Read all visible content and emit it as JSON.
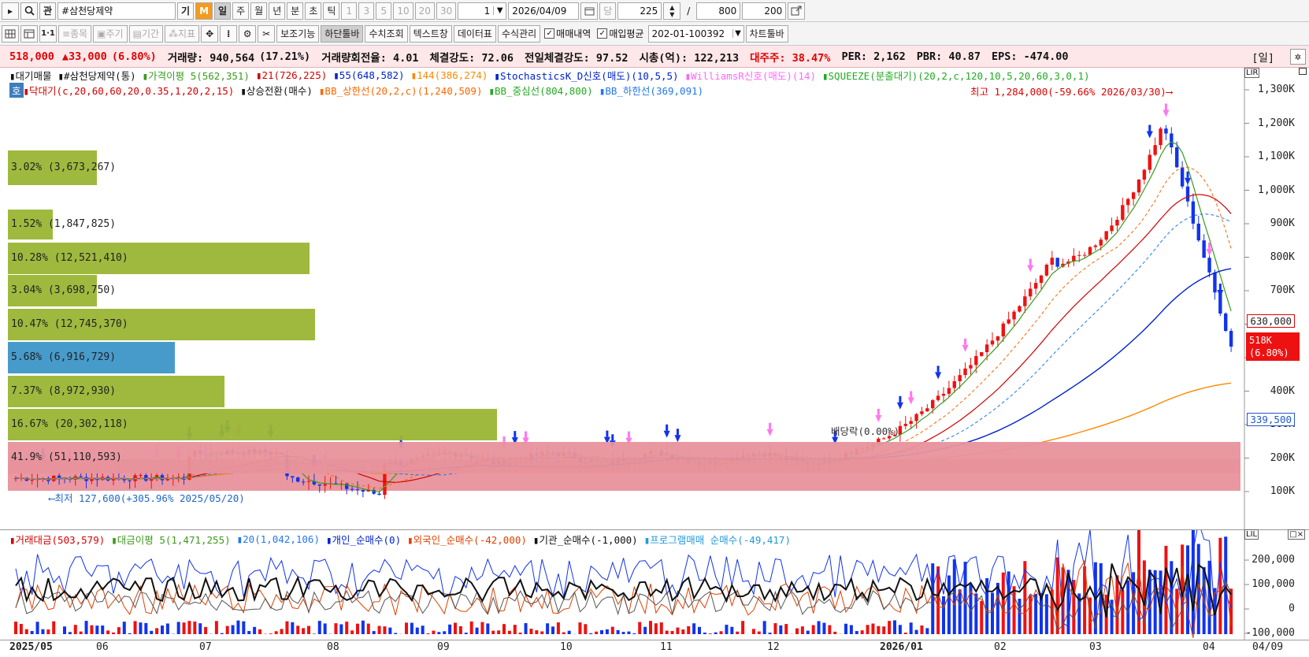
{
  "toolbar1": {
    "nav_arrow": "▸",
    "search_icon": "search-icon",
    "gwan_label": "관",
    "stock_name": "#삼천당제약",
    "gi_label": "기",
    "m_label": "M",
    "periods": [
      "일",
      "주",
      "월",
      "년",
      "분",
      "초",
      "틱"
    ],
    "minutes": [
      "1",
      "3",
      "5",
      "10",
      "20",
      "30"
    ],
    "count_value": "1",
    "date_value": "2026/04/09",
    "dang_label": "당",
    "view_count": "225",
    "slash": "/",
    "total_count": "800",
    "max_count": "200"
  },
  "toolbar2": {
    "left_items": [
      "종목",
      "주기",
      "기간",
      "지표"
    ],
    "buttons": [
      "보조기능",
      "하단툴바",
      "수치조회",
      "텍스트창",
      "데이터표",
      "수식관리"
    ],
    "check_trades": "매매내역",
    "check_avg": "매입평균",
    "account_value": "202-01-100392",
    "chart_toolbar": "차트툴바"
  },
  "infobar": {
    "price": "518,000",
    "change": "▲33,000",
    "change_pct": "(6.80%)",
    "volume": "거래량: 940,564",
    "volume_pct": "(17.21%)",
    "turnover": "거래량회전율: 4.01",
    "strength": "체결강도: 72.06",
    "prev_strength": "전일체결강도: 97.52",
    "market_cap": "시총(억): 122,213",
    "major_holder": "대주주: 38.47%",
    "per": "PER: 2,162",
    "pbr": "PBR: 40.87",
    "eps": "EPS: -474.00",
    "period_tag": "[일]"
  },
  "legend_row1": [
    {
      "text": "대기매물",
      "color": "#111111"
    },
    {
      "text": "#삼천당제약(통)",
      "color": "#111111"
    },
    {
      "text": "가격이평 5(562,351)",
      "color": "#3a9a1c"
    },
    {
      "text": "21(726,225)",
      "color": "#d40000"
    },
    {
      "text": "55(648,582)",
      "color": "#0022cc"
    },
    {
      "text": "144(386,274)",
      "color": "#ff8800"
    },
    {
      "text": "StochasticsK_D신호(매도)(10,5,5)",
      "color": "#0022cc"
    },
    {
      "text": "WilliamsR신호(매도)(14)",
      "color": "#ff66ff"
    },
    {
      "text": "SQUEEZE(분출대기)(20,2,c,120,10,5,20,60,3,0,1)",
      "color": "#22aa22"
    }
  ],
  "legend_row2": [
    {
      "text": "호",
      "color": "#ffffff"
    },
    {
      "text": "닥대기(c,20,60,60,20,0.35,1,20,2,15)",
      "color": "#d40000"
    },
    {
      "text": "상승전환(매수)",
      "color": "#111111"
    },
    {
      "text": "BB_상한선(20,2,c)(1,240,509)",
      "color": "#ff6600"
    },
    {
      "text": "BB_중심선(804,800)",
      "color": "#22aa22"
    },
    {
      "text": "BB_하한선(369,091)",
      "color": "#2277ee"
    }
  ],
  "annotations": {
    "high": "최고 1,284,000(-59.66% 2026/03/30)⟶",
    "low": "⟵최저 127,600(+305.96% 2025/05/20)",
    "dividend": "배당락(0.00%)"
  },
  "volume_profile": [
    {
      "label": "3.02% (3,673,267)",
      "pct": 3.02,
      "color": "#9ab534"
    },
    {
      "label": "1.52% (1,847,825)",
      "pct": 1.52,
      "color": "#9ab534"
    },
    {
      "label": "10.28% (12,521,410)",
      "pct": 10.28,
      "color": "#9ab534"
    },
    {
      "label": "3.04% (3,698,750)",
      "pct": 3.04,
      "color": "#9ab534"
    },
    {
      "label": "10.47% (12,745,370)",
      "pct": 10.47,
      "color": "#9ab534"
    },
    {
      "label": "5.68% (6,916,729)",
      "pct": 5.68,
      "color": "#3d96c8"
    },
    {
      "label": "7.37% (8,972,930)",
      "pct": 7.37,
      "color": "#9ab534"
    },
    {
      "label": "16.67% (20,302,118)",
      "pct": 16.67,
      "color": "#9ab534"
    },
    {
      "label": "41.9% (51,110,593)",
      "pct": 41.9,
      "color": "#e8929c"
    }
  ],
  "price_axis": [
    "1,300K",
    "1,200K",
    "1,100K",
    "1,000K",
    "900K",
    "800K",
    "700K",
    "600K",
    "500K",
    "400K",
    "300K",
    "200K",
    "100K"
  ],
  "price_tags": {
    "upper": "630,000",
    "current": "518K",
    "current_pct": "(6.80%)",
    "lower": "339,500"
  },
  "lower_legend": [
    {
      "text": "거래대금(503,579)",
      "color": "#d40000"
    },
    {
      "text": "대금이평 5(1,471,255)",
      "color": "#3a9a1c"
    },
    {
      "text": "20(1,042,106)",
      "color": "#2277ee"
    },
    {
      "text": "개인_순매수(0)",
      "color": "#0022cc"
    },
    {
      "text": "외국인_순매수(-42,000)",
      "color": "#e04000"
    },
    {
      "text": "기관_순매수(-1,000)",
      "color": "#111111"
    },
    {
      "text": "프로그램매매 순매수(-49,417)",
      "color": "#2299dd"
    }
  ],
  "lower_axis": [
    "200,000",
    "100,000",
    "0",
    "-100,000"
  ],
  "time_axis": [
    "2025/05",
    "06",
    "07",
    "08",
    "09",
    "10",
    "11",
    "12",
    "2026/01",
    "02",
    "03",
    "04",
    "04/09"
  ],
  "colors": {
    "up": "#ee1111",
    "down": "#1133ee",
    "highlight": "#fde7e9"
  }
}
